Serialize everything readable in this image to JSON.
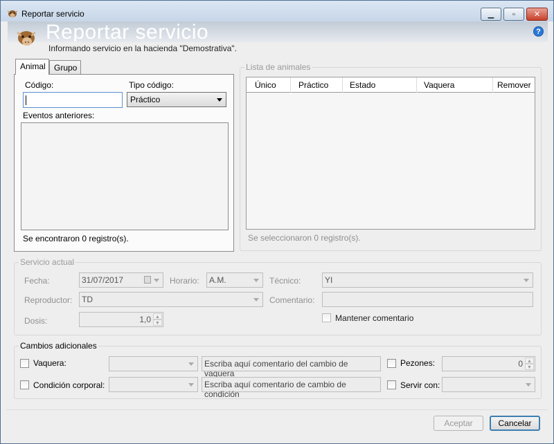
{
  "window": {
    "title": "Reportar servicio",
    "controls": {
      "minimize": "▁",
      "maximize": "▫",
      "close": "✕"
    }
  },
  "header": {
    "title": "Reportar servicio",
    "subtitle": "Informando servicio en la hacienda \"Demostrativa\".",
    "help_symbol": "?"
  },
  "tabs": [
    {
      "label": "Animal",
      "active": true
    },
    {
      "label": "Grupo",
      "active": false
    }
  ],
  "animal_tab": {
    "codigo_label": "Código:",
    "codigo_value": "",
    "tipo_codigo_label": "Tipo código:",
    "tipo_codigo_value": "Práctico",
    "eventos_label": "Eventos anteriores:",
    "status": "Se encontraron 0 registro(s)."
  },
  "lista_animales": {
    "legend": "Lista de animales",
    "columns": [
      "Único",
      "Práctico",
      "Estado",
      "Vaquera",
      "Remover"
    ],
    "rows": [],
    "status": "Se seleccionaron 0 registro(s)."
  },
  "servicio_actual": {
    "legend": "Servicio actual",
    "fecha_label": "Fecha:",
    "fecha_value": "31/07/2017",
    "horario_label": "Horario:",
    "horario_value": "A.M.",
    "tecnico_label": "Técnico:",
    "tecnico_value": "YI",
    "reproductor_label": "Reproductor:",
    "reproductor_value": "TD",
    "comentario_label": "Comentario:",
    "comentario_value": "",
    "dosis_label": "Dosis:",
    "dosis_value": "1,0",
    "mantener_label": "Mantener comentario"
  },
  "cambios_adicionales": {
    "legend": "Cambios adicionales",
    "vaquera_label": "Vaquera:",
    "vaquera_placeholder": "Escriba aquí comentario del cambio de vaquera",
    "condicion_label": "Condición corporal:",
    "condicion_placeholder": "Escriba aquí comentario de cambio de condición",
    "pezones_label": "Pezones:",
    "pezones_value": "0",
    "servir_label": "Servir con:"
  },
  "footer": {
    "aceptar": "Aceptar",
    "cancelar": "Cancelar"
  },
  "icons": {
    "app": "cow-head-icon",
    "help": "help-icon",
    "calendar": "calendar-icon"
  }
}
